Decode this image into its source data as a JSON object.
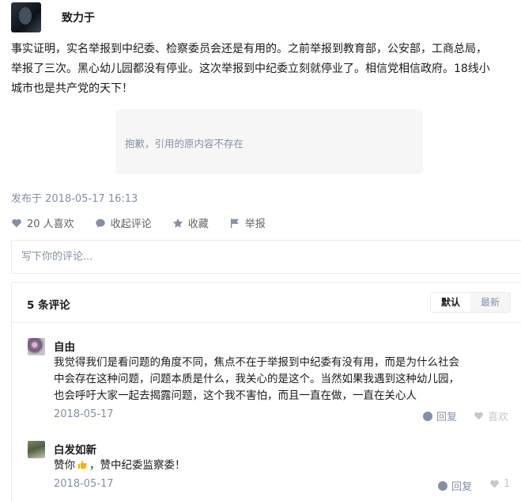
{
  "author": {
    "name": "致力于"
  },
  "post": {
    "lines": [
      "事实证明，实名举报到中纪委、检察委员会还是有用的。之前举报到教育部，公安部，工商总局，",
      "举报了三次。黑心幼儿园都没有停业。这次举报到中纪委立刻就停业了。相信党相信政府。18线小",
      "城市也是共产党的天下！"
    ],
    "quote_unavailable": "抱歉，引用的原内容不存在",
    "published": "发布于 2018-05-17 16:13"
  },
  "actions": {
    "likes": "20 人喜欢",
    "collapse_comments": "收起评论",
    "favorite": "收藏",
    "report": "举报"
  },
  "comment_input": {
    "placeholder": "写下你的评论..."
  },
  "comments": {
    "count_label": "5 条评论",
    "sort_default": "默认",
    "sort_latest": "最新",
    "items": [
      {
        "author": "自由",
        "lines": [
          "我觉得我们是看问题的角度不同，焦点不在于举报到中纪委有没有用，而是为什么社会",
          "中会存在这种问题，问题本质是什么，我关心的是这个。当然如果我遇到这种幼儿园，",
          "也会呼吁大家一起去揭露问题，这个我不害怕，而且一直在做，一直在关心人"
        ],
        "date": "2018-05-17",
        "reply": "回复",
        "like": "喜欢"
      },
      {
        "author": "白发如新",
        "text_before": "赞你",
        "text_after": "，赞中纪委监察委！",
        "emoji": "thumbs-up-icon",
        "date": "2018-05-17",
        "reply": "回复",
        "like_count": "1"
      }
    ]
  },
  "colors": {
    "meta_gray": "#8590a6",
    "border": "#ebebeb",
    "quote_bg": "#f6f6f6",
    "thumb_yellow": "#f5b400"
  }
}
